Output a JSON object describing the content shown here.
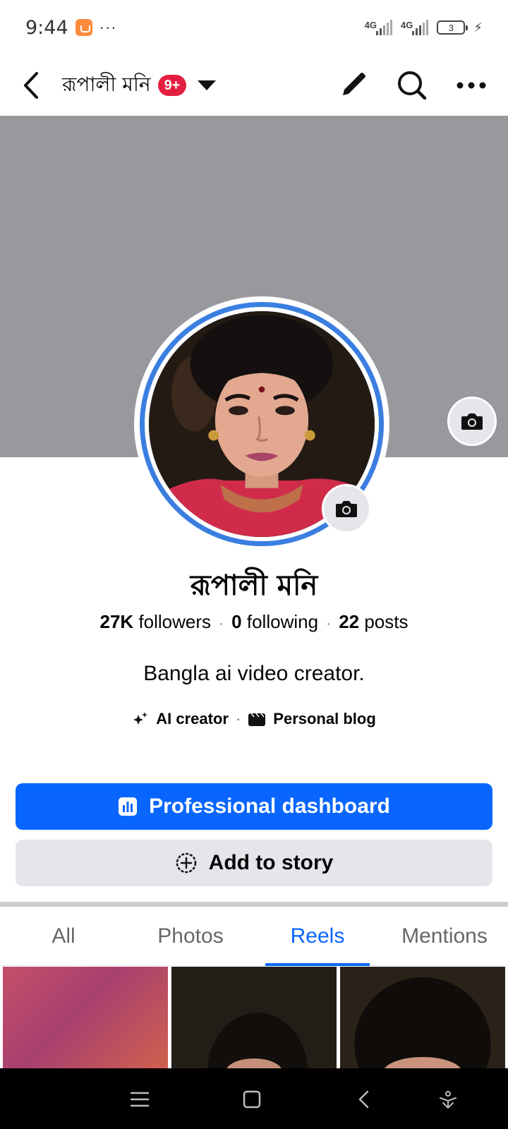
{
  "status_bar": {
    "time": "9:44",
    "more": "···",
    "network_1": "4G",
    "network_2": "4G",
    "battery": "3"
  },
  "top_nav": {
    "title": "রূপালী মনি",
    "badge": "9+"
  },
  "profile": {
    "name": "রূপালী মনি",
    "followers_count": "27K",
    "followers_label": "followers",
    "following_count": "0",
    "following_label": "following",
    "posts_count": "22",
    "posts_label": "posts",
    "bio": "Bangla ai video creator.",
    "categories": [
      "AI creator",
      "Personal blog"
    ]
  },
  "buttons": {
    "dashboard_label": "Professional dashboard",
    "story_label": "Add to story"
  },
  "tabs": [
    {
      "label": "All",
      "active": false
    },
    {
      "label": "Photos",
      "active": false
    },
    {
      "label": "Reels",
      "active": true
    },
    {
      "label": "Mentions",
      "active": false
    }
  ],
  "colors": {
    "accent": "#0866ff",
    "badge": "#e41e3f",
    "avatar_ring": "#3a7ee0",
    "cover": "#97999d"
  }
}
